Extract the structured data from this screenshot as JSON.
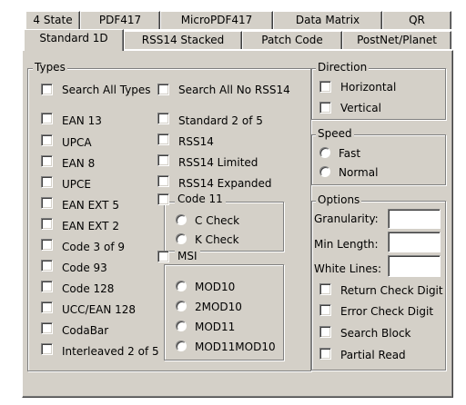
{
  "tabs_row1": [
    "4 State",
    "PDF417",
    "MicroPDF417",
    "Data Matrix",
    "QR"
  ],
  "tabs_row2": [
    "Standard 1D",
    "RSS14 Stacked",
    "Patch Code",
    "PostNet/Planet"
  ],
  "active_tab": "Standard 1D",
  "types": {
    "title": "Types",
    "search_all": "Search All Types",
    "search_all_no_rss": "Search All No RSS14",
    "left_col": [
      "EAN 13",
      "UPCA",
      "EAN 8",
      "UPCE",
      "EAN EXT 5",
      "EAN EXT 2",
      "Code 3 of 9",
      "Code 93",
      "Code 128",
      "UCC/EAN 128",
      "CodaBar",
      "Interleaved 2 of 5"
    ],
    "right_col": [
      "Standard 2 of 5",
      "RSS14",
      "RSS14 Limited",
      "RSS14 Expanded"
    ],
    "code11": {
      "label": "Code 11",
      "options": [
        "C Check",
        "K Check"
      ]
    },
    "msi": {
      "label": "MSI",
      "options": [
        "MOD10",
        "2MOD10",
        "MOD11",
        "MOD11MOD10"
      ]
    }
  },
  "direction": {
    "title": "Direction",
    "options": [
      "Horizontal",
      "Vertical"
    ]
  },
  "speed": {
    "title": "Speed",
    "options": [
      "Fast",
      "Normal"
    ]
  },
  "options": {
    "title": "Options",
    "fields": [
      "Granularity:",
      "Min Length:",
      "White Lines:"
    ],
    "field_values": [
      "",
      "",
      ""
    ],
    "checks": [
      "Return Check Digit",
      "Error Check Digit",
      "Search Block",
      "Partial Read"
    ]
  }
}
